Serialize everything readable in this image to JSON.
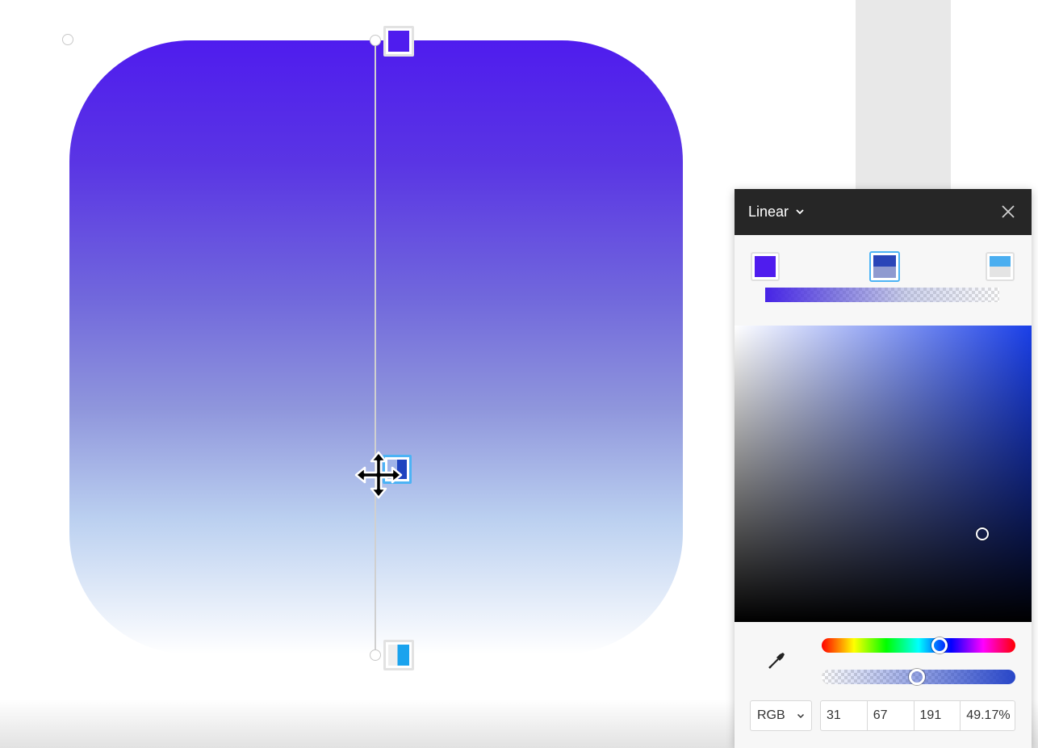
{
  "panel": {
    "gradient_type": "Linear",
    "color_mode": "RGB",
    "values": {
      "r": "31",
      "g": "67",
      "b": "191",
      "alpha": "49.17%"
    },
    "hue_position": 0.62,
    "alpha_position": 0.49
  },
  "gradient_stops": [
    {
      "color": "#4f1cee",
      "opacity": 1.0
    },
    {
      "color": "#1f43bf",
      "opacity": 0.49
    },
    {
      "color": "#1aa3ee",
      "opacity": 0.0
    }
  ],
  "colors": {
    "header_bg": "#262626",
    "selected_border": "#4cb3f5",
    "shape_top": "#4f1cee",
    "shape_bottom": "#ffffff"
  },
  "icons": {
    "dropdown": "chevron-down-icon",
    "close": "close-icon",
    "eyedropper": "eyedropper-icon",
    "move_cursor": "move-cursor-icon"
  }
}
